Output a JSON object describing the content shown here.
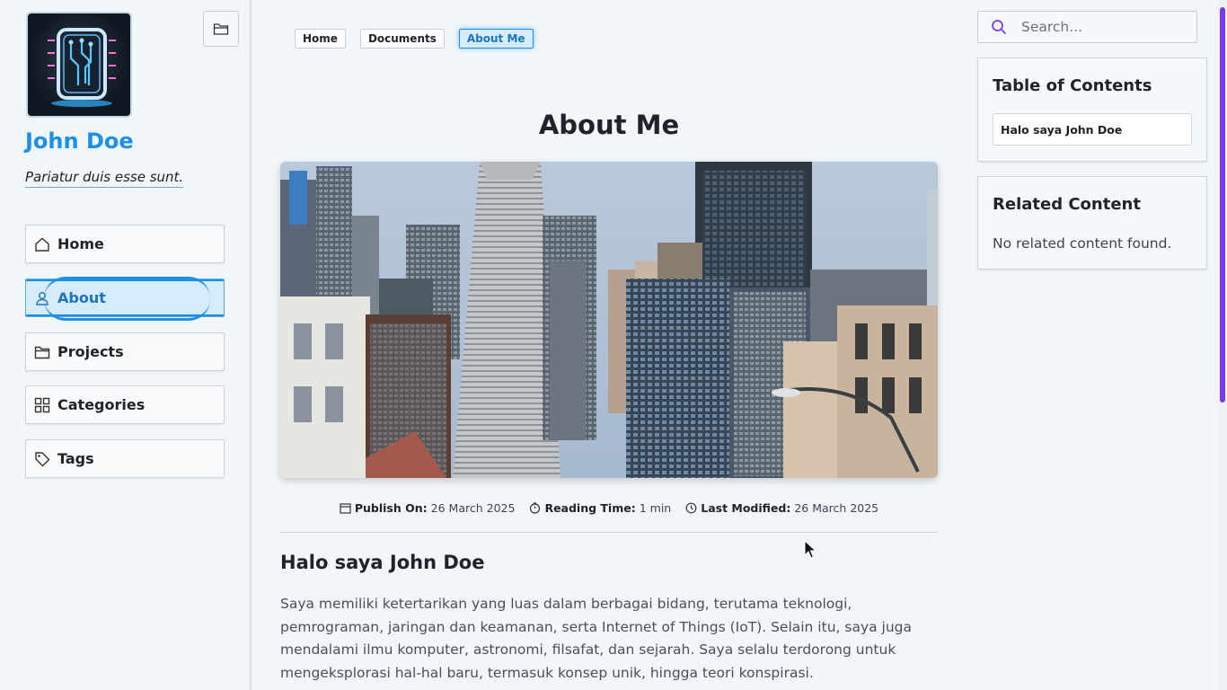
{
  "sidebar": {
    "avatar_icon": "circuit-chip-logo",
    "folder_icon": "folder-icon",
    "site_name": "John Doe",
    "tagline": "Pariatur duis esse sunt.",
    "nav": [
      {
        "label": "Home",
        "icon": "home-icon",
        "active": false
      },
      {
        "label": "About",
        "icon": "user-icon",
        "active": true
      },
      {
        "label": "Projects",
        "icon": "folder-icon",
        "active": false
      },
      {
        "label": "Categories",
        "icon": "grid-icon",
        "active": false
      },
      {
        "label": "Tags",
        "icon": "tag-icon",
        "active": false
      }
    ]
  },
  "breadcrumb": [
    "Home",
    "Documents",
    "About Me"
  ],
  "main": {
    "title": "About Me",
    "hero_alt": "City skyline with skyscrapers",
    "meta": {
      "publish_label": "Publish On:",
      "publish_value": "26 March 2025",
      "reading_label": "Reading Time:",
      "reading_value": "1 min",
      "modified_label": "Last Modified:",
      "modified_value": "26 March 2025"
    },
    "heading": "Halo saya John Doe",
    "paragraph": "Saya memiliki ketertarikan yang luas dalam berbagai bidang, terutama teknologi, pemrograman, jaringan dan keamanan, serta Internet of Things (IoT). Selain itu, saya juga mendalami ilmu komputer, astronomi, filsafat, dan sejarah. Saya selalu terdorong untuk mengeksplorasi hal-hal baru, termasuk konsep unik, hingga teori konspirasi."
  },
  "search": {
    "placeholder": "Search..."
  },
  "toc": {
    "title": "Table of Contents",
    "items": [
      "Halo saya  John Doe"
    ]
  },
  "related": {
    "title": "Related Content",
    "empty": "No related content found."
  },
  "colors": {
    "accent": "#1e8fe6",
    "scrollbar": "#7c3aed",
    "background": "#f1f6fb"
  }
}
